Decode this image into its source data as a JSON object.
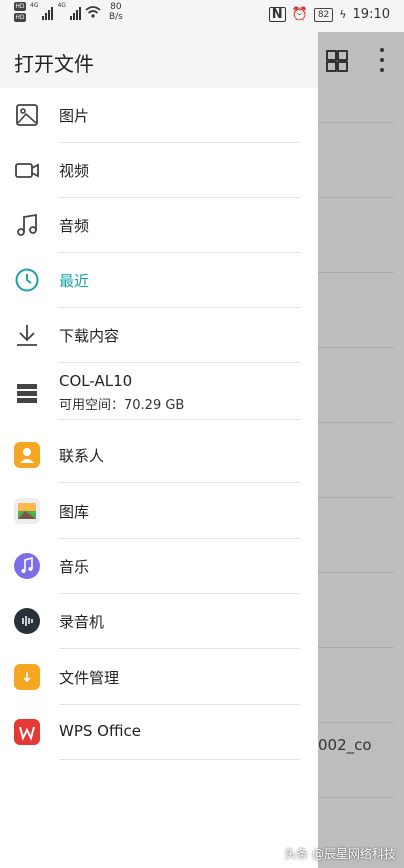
{
  "status_bar": {
    "hd1": "HD",
    "hd2": "HD",
    "net_label_1": "4G",
    "net_label_2": "4G",
    "speed_value": "80",
    "speed_unit": "B/s",
    "battery": "82",
    "time": "19:10"
  },
  "header": {
    "title": "打开文件"
  },
  "nav_items": [
    {
      "label": "图片"
    },
    {
      "label": "视频"
    },
    {
      "label": "音频"
    },
    {
      "label": "最近",
      "active": true
    },
    {
      "label": "下载内容"
    }
  ],
  "storage": {
    "name": "COL-AL10",
    "free": "可用空间：70.29 GB"
  },
  "apps": [
    {
      "label": "联系人"
    },
    {
      "label": "图库"
    },
    {
      "label": "音乐"
    },
    {
      "label": "录音机"
    },
    {
      "label": "文件管理"
    },
    {
      "label": "WPS Office"
    }
  ],
  "right_panel": {
    "partial_filename": "002_co"
  },
  "watermark": "头条 @辰星网络科技",
  "colors": {
    "accent": "#1aa3a8",
    "dim": "#bdbdbd"
  }
}
